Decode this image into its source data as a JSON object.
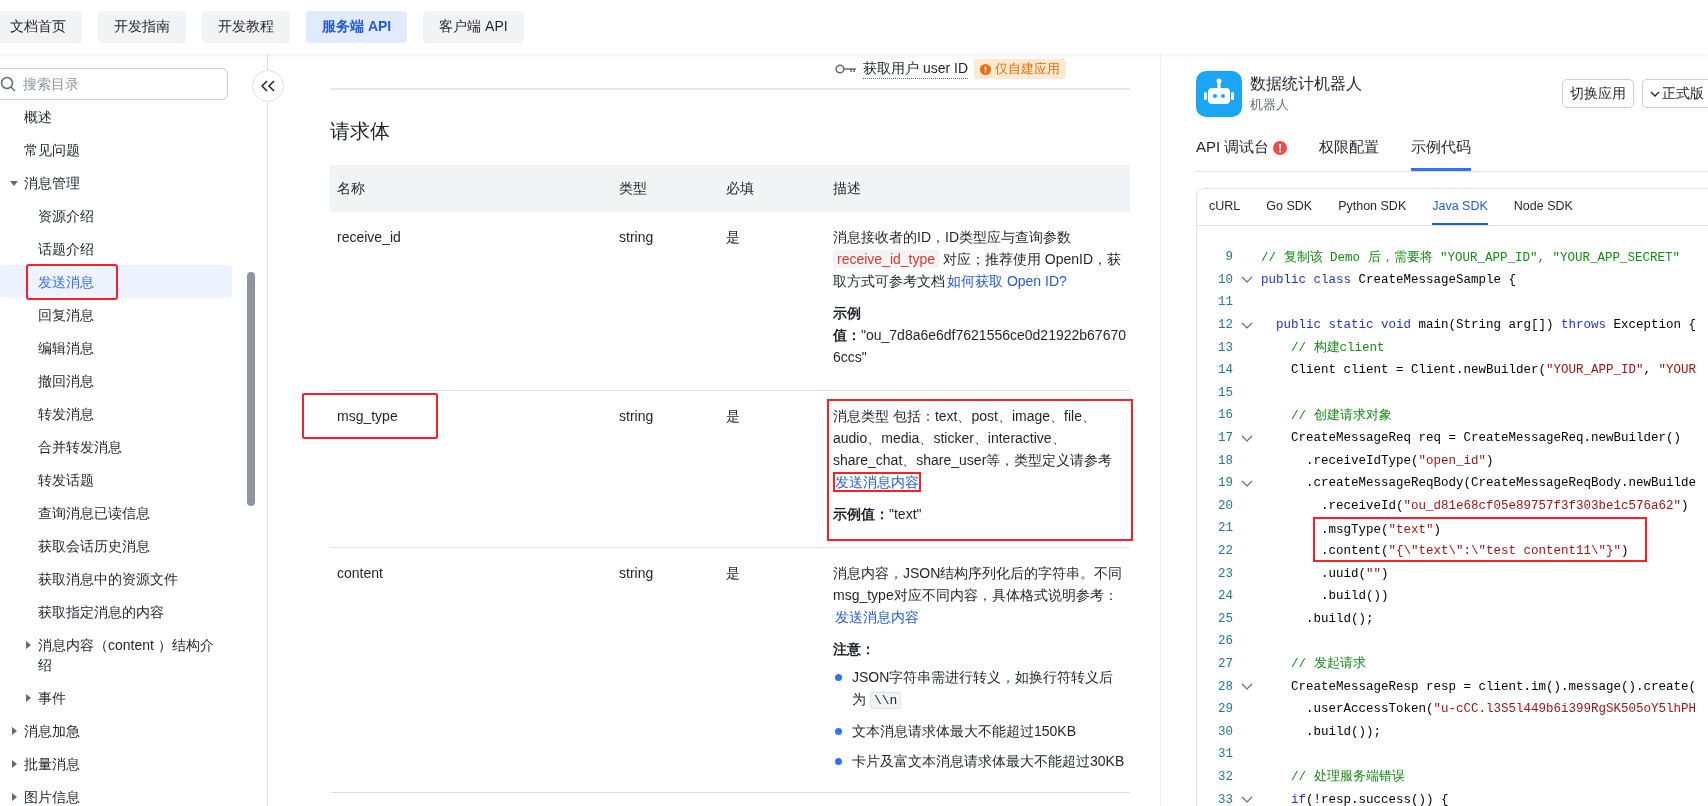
{
  "nav": {
    "tabs": [
      {
        "label": "文档首页",
        "selected": false
      },
      {
        "label": "开发指南",
        "selected": false
      },
      {
        "label": "开发教程",
        "selected": false
      },
      {
        "label": "服务端 API",
        "selected": true
      },
      {
        "label": "客户端 API",
        "selected": false
      }
    ]
  },
  "sidebar": {
    "search": {
      "placeholder": "搜索目录"
    },
    "items": [
      {
        "label": "概述",
        "kind": "page",
        "selected": false,
        "highlighted": false
      },
      {
        "label": "常见问题",
        "kind": "page",
        "selected": false,
        "highlighted": false
      },
      {
        "label": "消息管理",
        "kind": "folder",
        "expanded": true,
        "selected": false,
        "highlighted": false,
        "children": [
          {
            "label": "资源介绍",
            "kind": "page",
            "selected": false,
            "highlighted": false
          },
          {
            "label": "话题介绍",
            "kind": "page",
            "selected": false,
            "highlighted": false
          },
          {
            "label": "发送消息",
            "kind": "page",
            "selected": true,
            "highlighted": true
          },
          {
            "label": "回复消息",
            "kind": "page",
            "selected": false,
            "highlighted": false
          },
          {
            "label": "编辑消息",
            "kind": "page",
            "selected": false,
            "highlighted": false
          },
          {
            "label": "撤回消息",
            "kind": "page",
            "selected": false,
            "highlighted": false
          },
          {
            "label": "转发消息",
            "kind": "page",
            "selected": false,
            "highlighted": false
          },
          {
            "label": "合并转发消息",
            "kind": "page",
            "selected": false,
            "highlighted": false
          },
          {
            "label": "转发话题",
            "kind": "page",
            "selected": false,
            "highlighted": false
          },
          {
            "label": "查询消息已读信息",
            "kind": "page",
            "selected": false,
            "highlighted": false
          },
          {
            "label": "获取会话历史消息",
            "kind": "page",
            "selected": false,
            "highlighted": false
          },
          {
            "label": "获取消息中的资源文件",
            "kind": "page",
            "selected": false,
            "highlighted": false
          },
          {
            "label": "获取指定消息的内容",
            "kind": "page",
            "selected": false,
            "highlighted": false
          },
          {
            "label": "消息内容（content ）结构介绍",
            "kind": "folder",
            "expanded": false,
            "selected": false,
            "highlighted": false
          },
          {
            "label": "事件",
            "kind": "folder",
            "expanded": false,
            "selected": false,
            "highlighted": false
          }
        ]
      },
      {
        "label": "消息加急",
        "kind": "folder",
        "expanded": false,
        "selected": false,
        "highlighted": false
      },
      {
        "label": "批量消息",
        "kind": "folder",
        "expanded": false,
        "selected": false,
        "highlighted": false
      },
      {
        "label": "图片信息",
        "kind": "folder",
        "expanded": false,
        "selected": false,
        "highlighted": false
      }
    ]
  },
  "main": {
    "permission": {
      "label": "获取用户 user ID",
      "badge": "仅自建应用"
    },
    "section_title": "请求体",
    "table": {
      "columns": [
        "名称",
        "类型",
        "必填",
        "描述"
      ],
      "rows": [
        {
          "name": "receive_id",
          "type": "string",
          "required": "是",
          "name_highlighted": false,
          "desc_highlighted": false,
          "description": [
            {
              "kind": "para",
              "segments": [
                {
                  "kind": "text",
                  "text": "消息接收者的ID，ID类型应与查询参数 "
                },
                {
                  "kind": "code",
                  "text": "receive_id_type"
                },
                {
                  "kind": "text",
                  "text": " 对应；推荐使用 OpenID，获取方式可参考文档"
                },
                {
                  "kind": "link",
                  "text": "如何获取 Open ID?",
                  "highlighted": false
                }
              ]
            },
            {
              "kind": "example",
              "text": "**示例值：**\"ou_7d8a6e6df7621556ce0d21922b676706ccs\""
            }
          ]
        },
        {
          "name": "msg_type",
          "type": "string",
          "required": "是",
          "name_highlighted": true,
          "desc_highlighted": true,
          "description": [
            {
              "kind": "para",
              "segments": [
                {
                  "kind": "text",
                  "text": "消息类型 包括：text、post、image、file、audio、media、sticker、interactive、share_chat、share_user等，类型定义请参考 "
                },
                {
                  "kind": "link",
                  "text": "发送消息内容",
                  "highlighted": true
                }
              ]
            },
            {
              "kind": "example",
              "text": "**示例值：**\"text\""
            }
          ]
        },
        {
          "name": "content",
          "type": "string",
          "required": "是",
          "name_highlighted": false,
          "desc_highlighted": false,
          "description": [
            {
              "kind": "para",
              "segments": [
                {
                  "kind": "text",
                  "text": "消息内容，JSON结构序列化后的字符串。不同msg_type对应不同内容，具体格式说明参考："
                },
                {
                  "kind": "link",
                  "text": "发送消息内容",
                  "highlighted": false
                }
              ]
            },
            {
              "kind": "note",
              "text": "注意："
            },
            {
              "kind": "bullets",
              "items": [
                {
                  "segments": [
                    {
                      "kind": "text",
                      "text": "JSON字符串需进行转义，如换行符转义后为 "
                    },
                    {
                      "kind": "code",
                      "text": "\\\\n"
                    }
                  ]
                },
                {
                  "segments": [
                    {
                      "kind": "text",
                      "text": "文本消息请求体最大不能超过150KB"
                    }
                  ]
                },
                {
                  "segments": [
                    {
                      "kind": "text",
                      "text": "卡片及富文本消息请求体最大不能超过30KB"
                    }
                  ]
                }
              ]
            }
          ]
        }
      ]
    }
  },
  "panel": {
    "app": {
      "name": "数据统计机器人",
      "type": "机器人"
    },
    "buttons": [
      {
        "label": "切换应用",
        "kind": "plain"
      },
      {
        "label": "正式版",
        "kind": "dropdown"
      }
    ],
    "tabs": [
      {
        "label": "API 调试台",
        "selected": false,
        "alert": true
      },
      {
        "label": "权限配置",
        "selected": false,
        "alert": false
      },
      {
        "label": "示例代码",
        "selected": true,
        "alert": false
      }
    ],
    "sdk_tabs": [
      {
        "label": "cURL",
        "selected": false
      },
      {
        "label": "Go SDK",
        "selected": false
      },
      {
        "label": "Python SDK",
        "selected": false
      },
      {
        "label": "Java SDK",
        "selected": true
      },
      {
        "label": "Node SDK",
        "selected": false
      }
    ],
    "code": [
      {
        "number": "9",
        "fold": false,
        "highlighted": false,
        "tokens": [
          {
            "kind": "comment",
            "text": "// 复制该 Demo 后，需要将 \"YOUR_APP_ID\", \"YOUR_APP_SECRET\""
          }
        ]
      },
      {
        "number": "10",
        "fold": true,
        "highlighted": false,
        "tokens": [
          {
            "kind": "keyword",
            "text": "public class "
          },
          {
            "kind": "plain",
            "text": "CreateMessageSample {"
          }
        ]
      },
      {
        "number": "11",
        "fold": false,
        "highlighted": false
      },
      {
        "number": "12",
        "fold": true,
        "highlighted": false,
        "tokens": [
          {
            "kind": "keyword",
            "text": "  public static void "
          },
          {
            "kind": "plain",
            "text": "main(String arg[]) "
          },
          {
            "kind": "keyword",
            "text": "throws "
          },
          {
            "kind": "plain",
            "text": "Exception {"
          }
        ]
      },
      {
        "number": "13",
        "fold": false,
        "highlighted": false,
        "tokens": [
          {
            "kind": "comment",
            "text": "    // 构建client"
          }
        ]
      },
      {
        "number": "14",
        "fold": false,
        "highlighted": false,
        "tokens": [
          {
            "kind": "plain",
            "text": "    Client client = Client.newBuilder("
          },
          {
            "kind": "string",
            "text": "\"YOUR_APP_ID\""
          },
          {
            "kind": "plain",
            "text": ", "
          },
          {
            "kind": "string",
            "text": "\"YOUR"
          }
        ]
      },
      {
        "number": "15",
        "fold": false,
        "highlighted": false
      },
      {
        "number": "16",
        "fold": false,
        "highlighted": false,
        "tokens": [
          {
            "kind": "comment",
            "text": "    // 创建请求对象"
          }
        ]
      },
      {
        "number": "17",
        "fold": true,
        "highlighted": false,
        "tokens": [
          {
            "kind": "plain",
            "text": "    CreateMessageReq req = CreateMessageReq.newBuilder()"
          }
        ]
      },
      {
        "number": "18",
        "fold": false,
        "highlighted": false,
        "tokens": [
          {
            "kind": "plain",
            "text": "      .receiveIdType("
          },
          {
            "kind": "string",
            "text": "\"open_id\""
          },
          {
            "kind": "plain",
            "text": ")"
          }
        ]
      },
      {
        "number": "19",
        "fold": true,
        "highlighted": false,
        "tokens": [
          {
            "kind": "plain",
            "text": "      .createMessageReqBody(CreateMessageReqBody.newBuilde"
          }
        ]
      },
      {
        "number": "20",
        "fold": false,
        "highlighted": false,
        "tokens": [
          {
            "kind": "plain",
            "text": "        .receiveId("
          },
          {
            "kind": "string",
            "text": "\"ou_d81e68cf05e89757f3f303be1c576a62\""
          },
          {
            "kind": "plain",
            "text": ")"
          }
        ]
      },
      {
        "number": "21",
        "fold": false,
        "highlighted": true,
        "tokens": [
          {
            "kind": "plain",
            "text": "        .msgType("
          },
          {
            "kind": "string",
            "text": "\"text\""
          },
          {
            "kind": "plain",
            "text": ")"
          }
        ]
      },
      {
        "number": "22",
        "fold": false,
        "highlighted": true,
        "tokens": [
          {
            "kind": "plain",
            "text": "        .content("
          },
          {
            "kind": "string",
            "text": "\"{\\\"text\\\":\\\"test content11\\\"}\""
          },
          {
            "kind": "plain",
            "text": ")"
          }
        ]
      },
      {
        "number": "23",
        "fold": false,
        "highlighted": false,
        "tokens": [
          {
            "kind": "plain",
            "text": "        .uuid("
          },
          {
            "kind": "string",
            "text": "\"\""
          },
          {
            "kind": "plain",
            "text": ")"
          }
        ]
      },
      {
        "number": "24",
        "fold": false,
        "highlighted": false,
        "tokens": [
          {
            "kind": "plain",
            "text": "        .build())"
          }
        ]
      },
      {
        "number": "25",
        "fold": false,
        "highlighted": false,
        "tokens": [
          {
            "kind": "plain",
            "text": "      .build();"
          }
        ]
      },
      {
        "number": "26",
        "fold": false,
        "highlighted": false
      },
      {
        "number": "27",
        "fold": false,
        "highlighted": false,
        "tokens": [
          {
            "kind": "comment",
            "text": "    // 发起请求"
          }
        ]
      },
      {
        "number": "28",
        "fold": true,
        "highlighted": false,
        "tokens": [
          {
            "kind": "plain",
            "text": "    CreateMessageResp resp = client.im().message().create("
          }
        ]
      },
      {
        "number": "29",
        "fold": false,
        "highlighted": false,
        "tokens": [
          {
            "kind": "plain",
            "text": "      .userAccessToken("
          },
          {
            "kind": "string",
            "text": "\"u-cCC.l3S5l449b6i399RgSK505oY5lhPH"
          }
        ]
      },
      {
        "number": "30",
        "fold": false,
        "highlighted": false,
        "tokens": [
          {
            "kind": "plain",
            "text": "      .build());"
          }
        ]
      },
      {
        "number": "31",
        "fold": false,
        "highlighted": false
      },
      {
        "number": "32",
        "fold": false,
        "highlighted": false,
        "tokens": [
          {
            "kind": "comment",
            "text": "    // 处理服务端错误"
          }
        ]
      },
      {
        "number": "33",
        "fold": true,
        "highlighted": false,
        "tokens": [
          {
            "kind": "keyword",
            "text": "    if"
          },
          {
            "kind": "plain",
            "text": "(!resp.success()) {"
          }
        ]
      }
    ]
  }
}
